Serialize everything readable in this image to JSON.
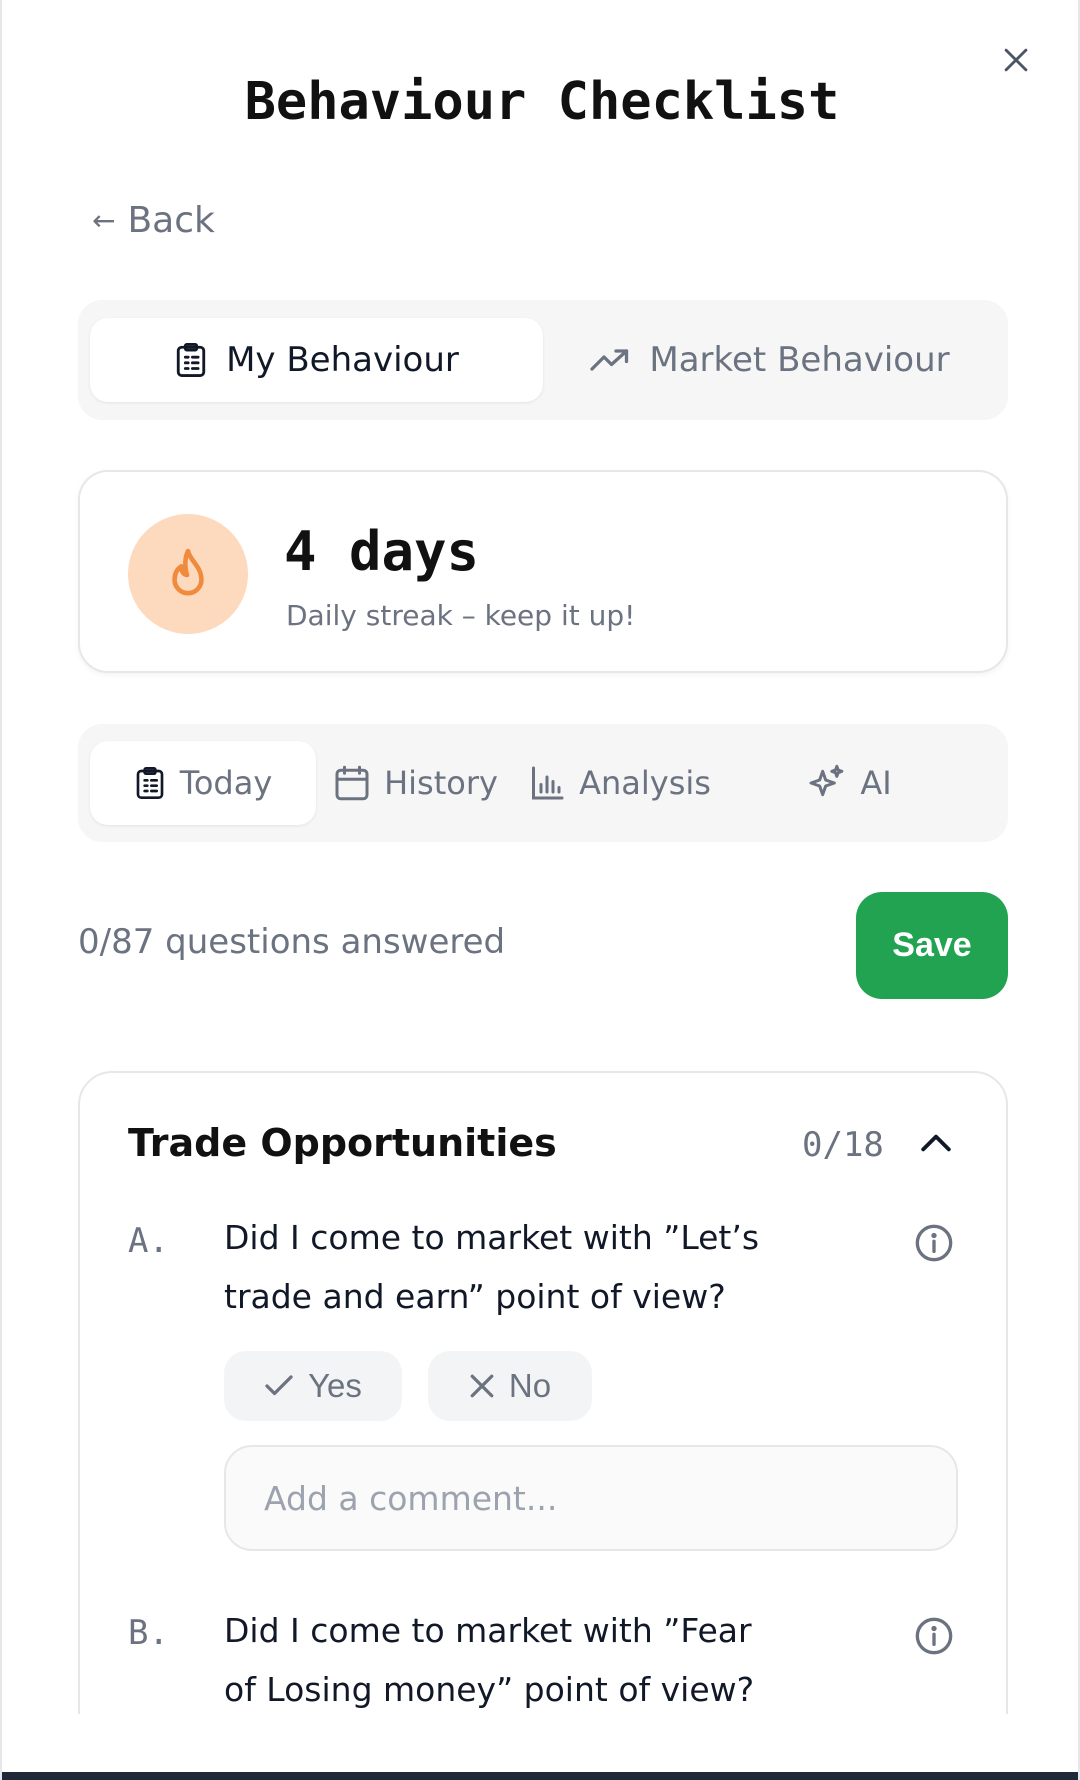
{
  "header": {
    "title": "Behaviour Checklist",
    "close_icon": "close-icon"
  },
  "nav": {
    "back_label": "Back",
    "back_arrow": "←"
  },
  "mode_tabs": [
    {
      "label": "My Behaviour",
      "icon": "clipboard-icon",
      "active": true
    },
    {
      "label": "Market Behaviour",
      "icon": "trending-up-icon",
      "active": false
    }
  ],
  "streak": {
    "value": "4 days",
    "subtitle": "Daily streak – keep it up!",
    "icon": "flame-icon",
    "accent": "#f08a3c",
    "bg": "#fdd9bd"
  },
  "view_tabs": [
    {
      "label": "Today",
      "icon": "clipboard-icon",
      "active": true
    },
    {
      "label": "History",
      "icon": "calendar-icon",
      "active": false
    },
    {
      "label": "Analysis",
      "icon": "bar-chart-icon",
      "active": false
    },
    {
      "label": "AI",
      "icon": "sparkles-icon",
      "active": false
    }
  ],
  "progress": {
    "text": "0/87 questions answered",
    "save_label": "Save",
    "save_color": "#22a352"
  },
  "section": {
    "title": "Trade Opportunities",
    "count": "0/18",
    "questions": [
      {
        "letter": "A.",
        "text": "Did I come to market with ”Let’s trade and earn” point of view?",
        "yes_label": "Yes",
        "no_label": "No",
        "comment_placeholder": "Add a comment..."
      },
      {
        "letter": "B.",
        "text": "Did I come to market with ”Fear of Losing money” point of view?"
      }
    ]
  }
}
